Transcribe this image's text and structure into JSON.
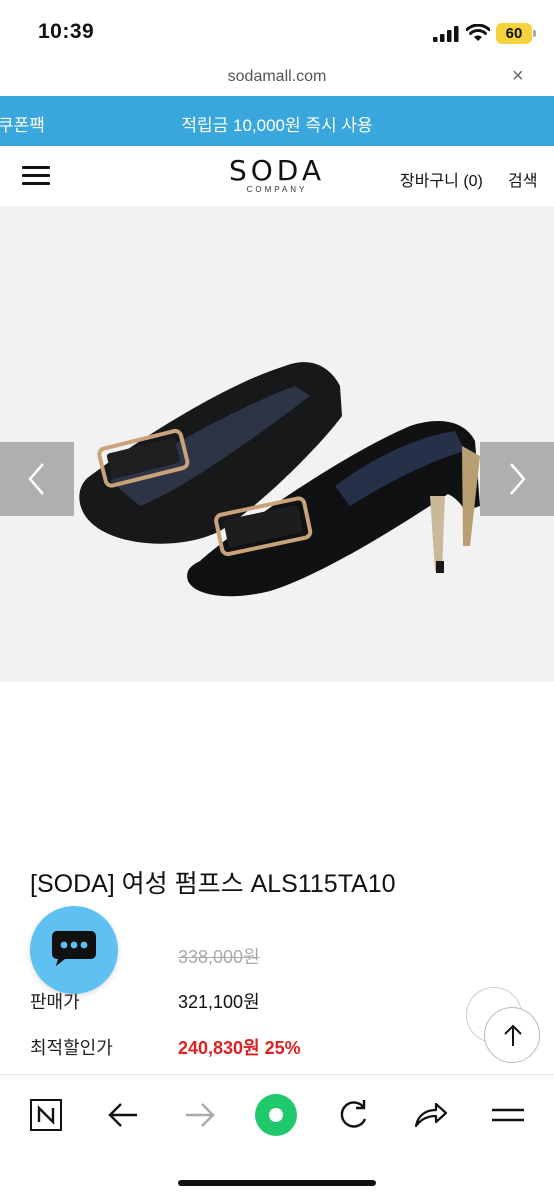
{
  "status_bar": {
    "time": "10:39",
    "battery": "60"
  },
  "browser": {
    "url": "sodamall.com",
    "close_glyph": "×"
  },
  "promo": {
    "left_text": "쿠폰팩",
    "text": "적립금 10,000원 즉시 사용",
    "color": "#3aa7dc"
  },
  "header": {
    "logo_main": "SODA",
    "logo_sub": "COMPANY",
    "cart_label": "장바구니 (0)",
    "search_label": "검색"
  },
  "gallery": {
    "prev_icon": "chevron-left-icon",
    "next_icon": "chevron-right-icon"
  },
  "product": {
    "title": "[SODA] 여성 펌프스 ALS115TA10",
    "original_price": "338,000원",
    "sale_label": "판매가",
    "sale_price": "321,100원",
    "best_label": "최적할인가",
    "best_price": "240,830원 25%",
    "best_color": "#e02020"
  },
  "toolbar": {
    "icons": [
      "naver-n-icon",
      "back-arrow-icon",
      "forward-arrow-icon",
      "green-dot-icon",
      "refresh-icon",
      "share-icon",
      "menu-icon"
    ],
    "accent": "#1ec86b"
  }
}
